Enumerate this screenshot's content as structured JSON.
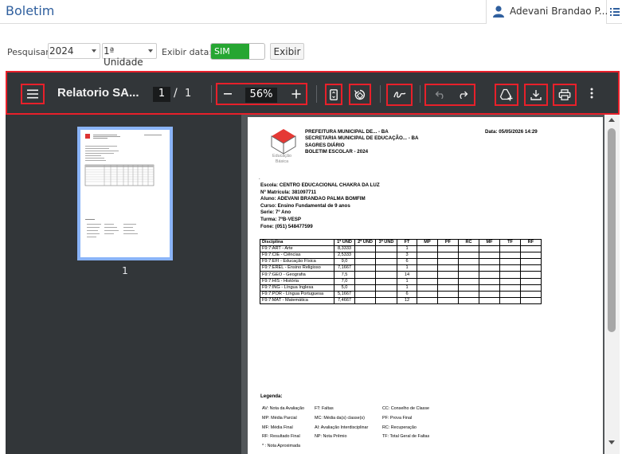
{
  "header": {
    "title": "Boletim",
    "user_name": "Adevani Brandao P..."
  },
  "filters": {
    "search_label": "Pesquisar:",
    "year": "2024",
    "unit": "1ª Unidade",
    "show_date_label": "Exibir data:",
    "toggle_on": "SIM",
    "show_button": "Exibir"
  },
  "viewer": {
    "doc_title": "Relatorio SA...",
    "current_page": "1",
    "page_sep": "/",
    "total_pages": "1",
    "zoom": "56%",
    "thumb_number": "1"
  },
  "report": {
    "org_lines": [
      "PREFEITURA MUNICIPAL DE... - BA",
      "SECRETARIA MUNICIPAL DE EDUCAÇÃO... - BA",
      "SAGRES DIÁRIO",
      "BOLETIM ESCOLAR - 2024"
    ],
    "date": "Data:   05/05/2026 14:29",
    "logo_text_1": "Educação",
    "logo_text_2": "Básica",
    "info_lines": [
      "Escola: CENTRO EDUCACIONAL CHAKRA DA LUZ",
      "Nº Matrícula: 381097711",
      "Aluno: ADEVANI BRANDAO PALMA BOMFIM",
      "Curso: Ensino Fundamental de 9 anos",
      "Serie:  7º Ano",
      "Turma:  7ºB-VESP",
      "Fone: (051) 548477599"
    ],
    "table_headers": [
      "Disciplina",
      "1º UND",
      "2º UND",
      "3º UND",
      "FT",
      "MP",
      "PF",
      "RC",
      "MF",
      "TF",
      "RF"
    ],
    "rows": [
      {
        "subject": "F9:7:ART - Arte",
        "und1": "8,3333",
        "ft": "1"
      },
      {
        "subject": "F9:7:CIE - Ciências",
        "und1": "2,5333",
        "ft": "3"
      },
      {
        "subject": "F9:7:EFI - Educação Física",
        "und1": "9,0",
        "ft": "6"
      },
      {
        "subject": "F9:7:EREL - Ensino Religioso",
        "und1": "7,1667",
        "ft": "1"
      },
      {
        "subject": "F9:7:GEO - Geografia",
        "und1": "7,5",
        "ft": "14"
      },
      {
        "subject": "F9:7:HIS - História",
        "und1": "7,0",
        "ft": "1"
      },
      {
        "subject": "F9:7:ING - Língua Inglesa",
        "und1": "5,0",
        "ft": "1"
      },
      {
        "subject": "F9:7:POR - Língua Portuguesa",
        "und1": "5,1667",
        "ft": "6"
      },
      {
        "subject": "F9:7:MAT - Matemática",
        "und1": "7,4667",
        "ft": "12"
      }
    ],
    "legend_title": "Legenda:",
    "legend_col1": [
      "AV: Nota da Avaliação",
      "MP: Média Parcial",
      "MF: Média Final",
      "RF: Resultado Final",
      "* : Nota Aproximada"
    ],
    "legend_col2": [
      "FT: Faltas",
      "MC: Média da(s) classe(s)",
      "AI: Avaliação Interdisciplinar",
      "NP: Nota Prêmio"
    ],
    "legend_col3": [
      "CC: Conselho de Classe",
      "PF: Prova Final",
      "RC: Recuperação",
      "TF: Total Geral de Faltas"
    ]
  },
  "colors": {
    "accent": "#2f5f9e",
    "toggle_green": "#26a632",
    "highlight_red": "#e8202a",
    "viewer_dark": "#323639"
  }
}
